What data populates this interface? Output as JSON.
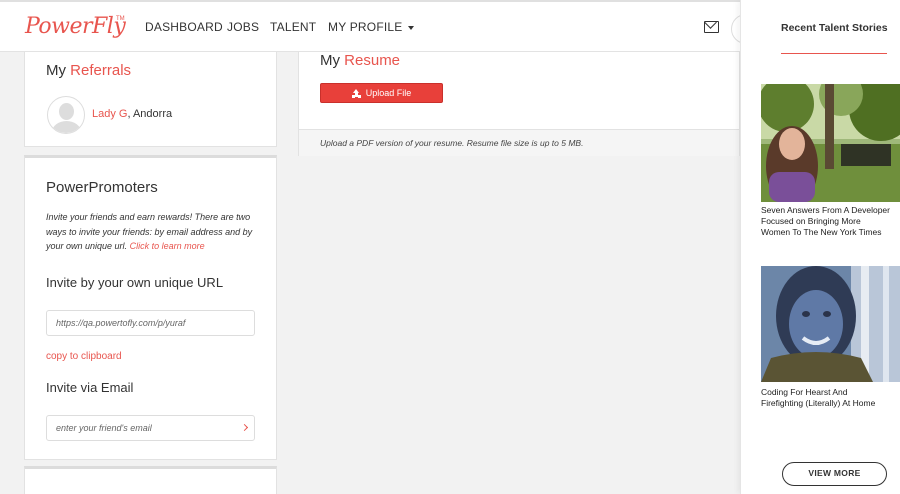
{
  "brand": {
    "logo_text": "PowerFly",
    "trademark": "TM",
    "accent": "#e8554e"
  },
  "nav": {
    "items": [
      "DASHBOARD",
      "JOBS",
      "TALENT"
    ],
    "profile_label": "MY PROFILE",
    "mail_icon": "envelope-icon"
  },
  "referrals": {
    "title_prefix": "My",
    "title_accent": "Referrals",
    "person_name": "Lady G",
    "person_location": ", Andorra"
  },
  "promoters": {
    "title": "PowerPromoters",
    "description": "Invite your friends and earn rewards! There are two ways to invite your friends: by email address and by your own unique url.",
    "learn_more": "Click to learn more",
    "url_heading": "Invite by your own unique URL",
    "url_value": "https://qa.powertofly.com/p/yuraf",
    "copy_label": "copy to clipboard",
    "email_heading": "Invite via Email",
    "email_placeholder": "enter your friend's email"
  },
  "resume": {
    "title_prefix": "My",
    "title_accent": "Resume",
    "upload_label": "Upload File",
    "note": "Upload a PDF version of your resume. Resume file size is up to 5 MB."
  },
  "stories": {
    "title": "Recent Talent Stories",
    "items": [
      {
        "caption_lines": [
          "Seven Answers From A Developer",
          "Focused on Bringing More",
          "Women To The New York Times"
        ]
      },
      {
        "caption_lines": [
          "Coding For Hearst And",
          "Firefighting (Literally) At Home"
        ]
      }
    ],
    "view_more": "VIEW MORE"
  }
}
